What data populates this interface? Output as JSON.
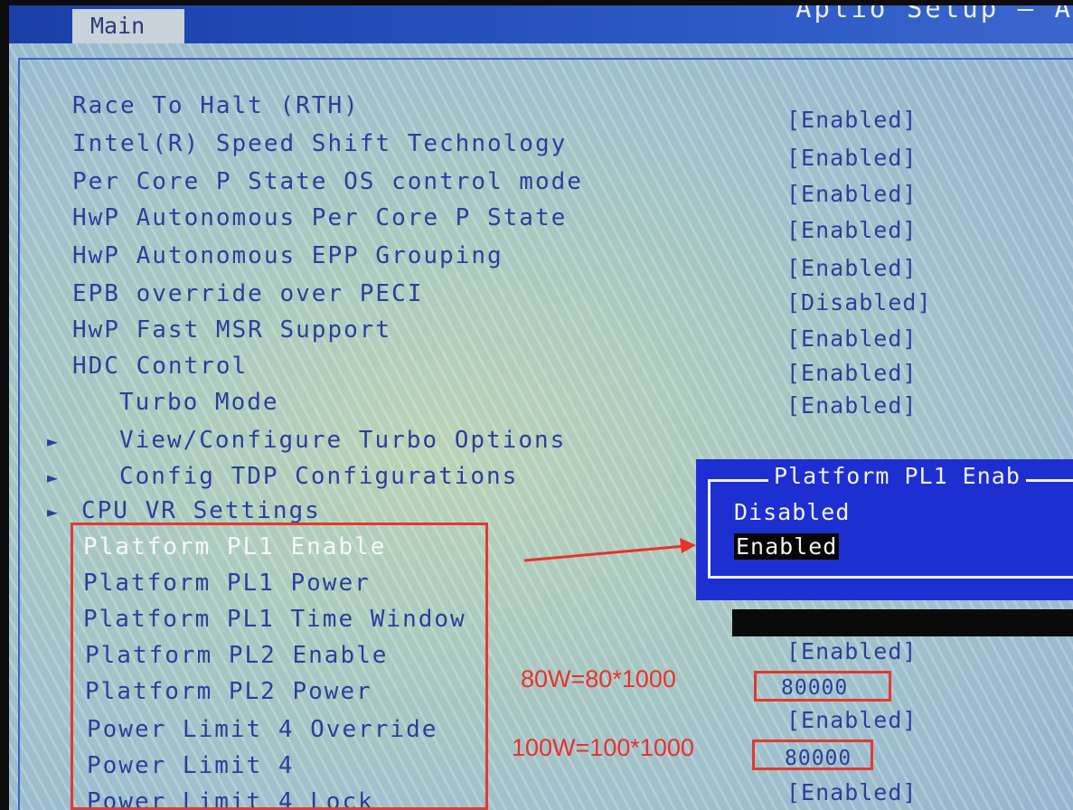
{
  "header": {
    "tab_main": "Main",
    "app_title": "Aptio Setup – A"
  },
  "menu": {
    "items": [
      {
        "label": "Race To Halt (RTH)",
        "value": "[Enabled]"
      },
      {
        "label": "Intel(R) Speed Shift Technology",
        "value": "[Enabled]"
      },
      {
        "label": "Per Core P State OS control mode",
        "value": "[Enabled]"
      },
      {
        "label": "HwP Autonomous Per Core P State",
        "value": "[Enabled]"
      },
      {
        "label": "HwP Autonomous EPP Grouping",
        "value": "[Enabled]"
      },
      {
        "label": "EPB override over PECI",
        "value": "[Disabled]"
      },
      {
        "label": "HwP Fast MSR Support",
        "value": "[Enabled]"
      },
      {
        "label": "HDC Control",
        "value": "[Enabled]"
      },
      {
        "label": "Turbo Mode",
        "value": "[Enabled]"
      },
      {
        "label": "View/Configure Turbo Options",
        "value": ""
      },
      {
        "label": "Config TDP Configurations",
        "value": ""
      },
      {
        "label": "CPU VR Settings",
        "value": ""
      },
      {
        "label": "Platform PL1 Enable",
        "value": ""
      },
      {
        "label": "Platform PL1 Power",
        "value": ""
      },
      {
        "label": "Platform PL1 Time Window",
        "value": ""
      },
      {
        "label": "Platform PL2 Enable",
        "value": "[Enabled]"
      },
      {
        "label": "Platform PL2 Power",
        "value": "80000"
      },
      {
        "label": "Power Limit 4 Override",
        "value": "[Enabled]"
      },
      {
        "label": "Power Limit 4",
        "value": "80000"
      },
      {
        "label": "Power Limit 4 Lock",
        "value": "[Enabled]"
      }
    ],
    "submenu_arrow": "►",
    "selected_item": "Platform PL1 Enable"
  },
  "popup": {
    "title": "Platform PL1 Enab",
    "options": [
      "Disabled",
      "Enabled"
    ],
    "selected_option": "Enabled"
  },
  "annotations": {
    "note_pl2": "80W=80*1000",
    "note_pl4": "100W=100*1000",
    "color": "#e8322a"
  }
}
